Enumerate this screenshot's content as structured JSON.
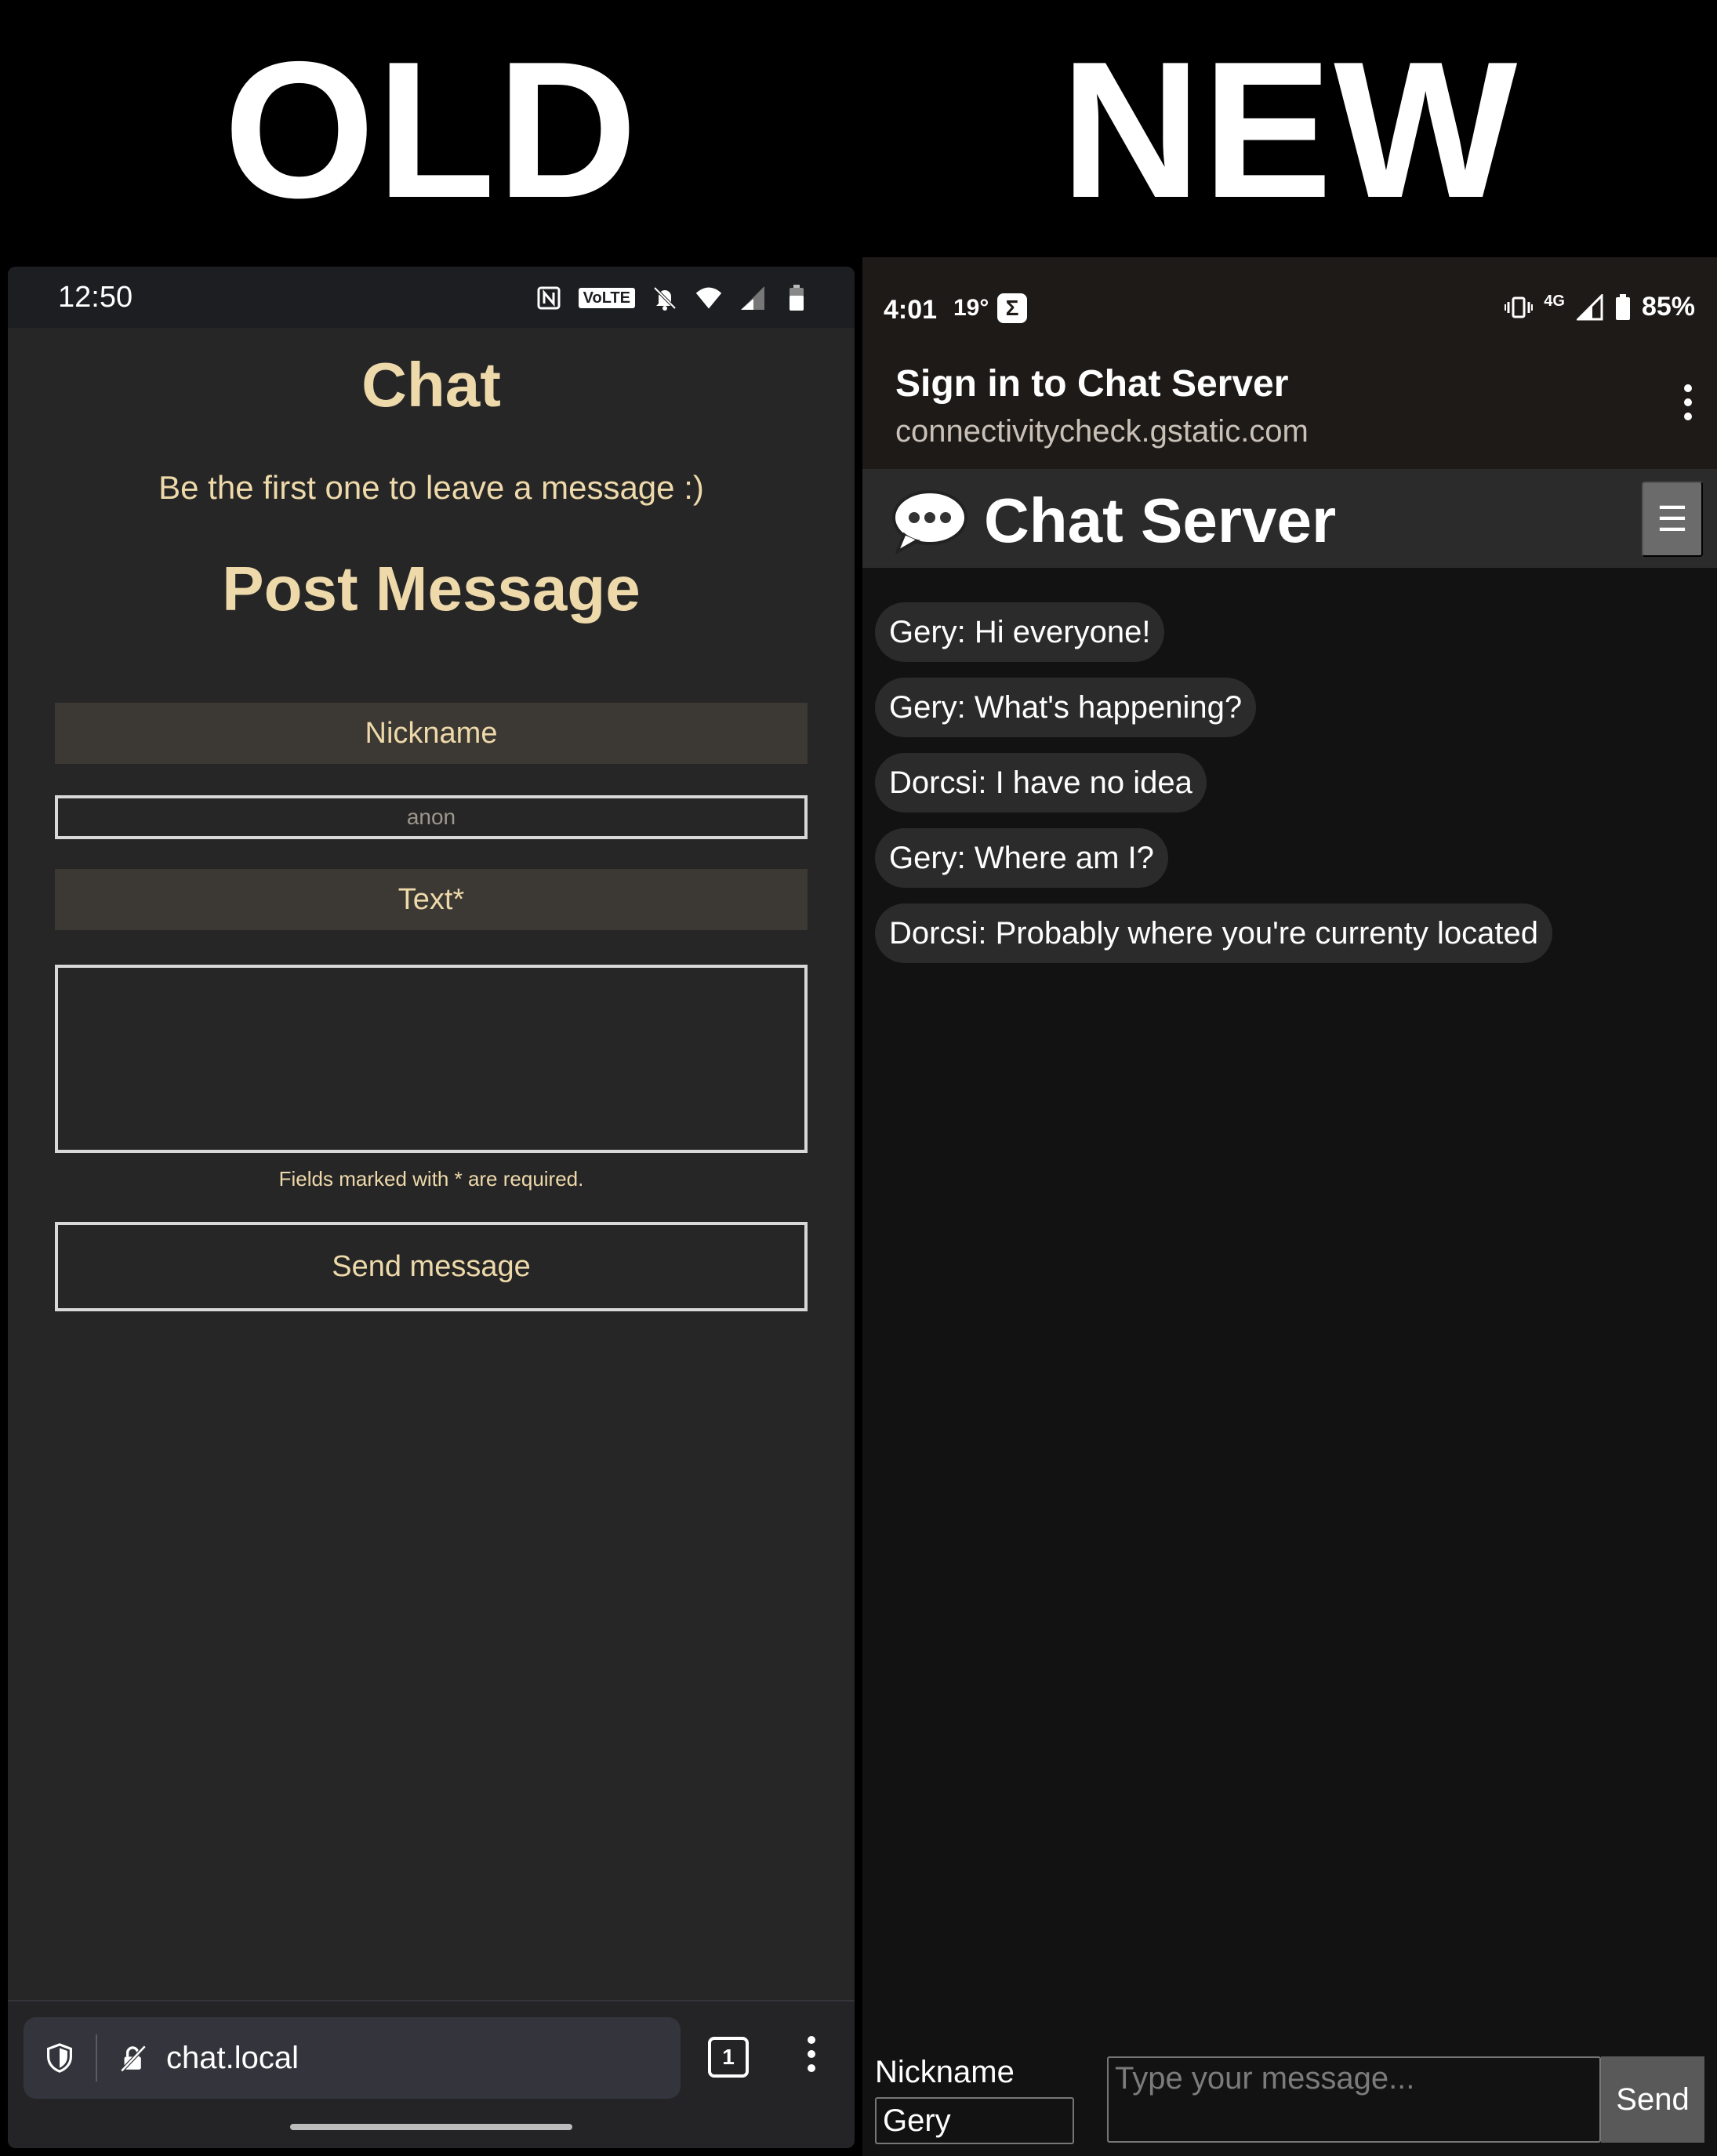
{
  "banners": {
    "old": "OLD",
    "new": "NEW"
  },
  "old_screen": {
    "status_bar": {
      "time": "12:50",
      "volte": "VoLTE",
      "icons": [
        "nfc-icon",
        "volte-icon",
        "bell-off-icon",
        "wifi-icon",
        "signal-icon",
        "battery-icon"
      ]
    },
    "title": "Chat",
    "subtitle": "Be the first one to leave a message :)",
    "post_heading": "Post Message",
    "form": {
      "nickname_label": "Nickname",
      "nickname_placeholder": "anon",
      "text_label": "Text*",
      "text_value": "",
      "required_note": "Fields marked with * are required.",
      "send_label": "Send message"
    },
    "browser_bar": {
      "url": "chat.local",
      "tab_count": "1",
      "icons": [
        "shield-icon",
        "insecure-lock-icon",
        "tabs-icon",
        "more-vert-icon"
      ]
    }
  },
  "new_screen": {
    "status_bar": {
      "time": "4:01",
      "temperature": "19°",
      "app_icon_letter": "Σ",
      "network": "4G",
      "battery": "85%",
      "icons": [
        "vibrate-icon",
        "signal-icon",
        "battery-icon"
      ]
    },
    "captive_portal": {
      "title": "Sign in to Chat Server",
      "url": "connectivitycheck.gstatic.com"
    },
    "app_bar": {
      "title": "Chat Server",
      "menu_glyph": "☰",
      "icons": [
        "speech-bubble-icon"
      ]
    },
    "messages": [
      {
        "text": "Gery: Hi everyone!"
      },
      {
        "text": "Gery: What's happening?"
      },
      {
        "text": "Dorcsi: I have no idea"
      },
      {
        "text": "Gery: Where am I?"
      },
      {
        "text": "Dorcsi: Probably where you're currenty located"
      }
    ],
    "composer": {
      "nickname_label": "Nickname",
      "nickname_value": "Gery",
      "message_placeholder": "Type your message...",
      "send_label": "Send"
    }
  },
  "colors": {
    "old_accent": "#eed9aa",
    "old_background": "#262626",
    "new_background": "#121212",
    "new_bubble": "#2b2b2b"
  }
}
